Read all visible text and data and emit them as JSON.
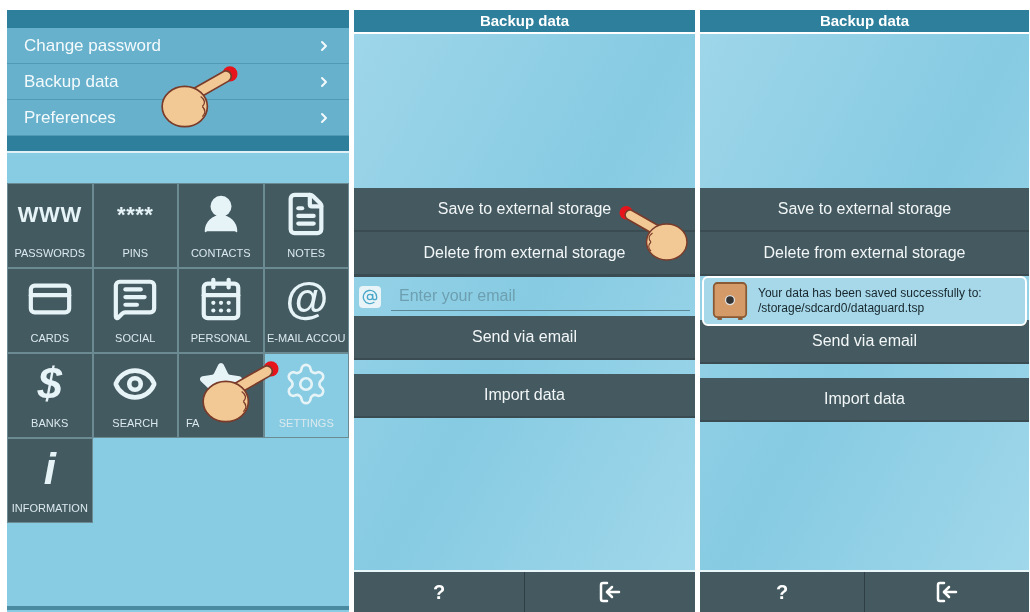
{
  "screens": [
    {
      "kind": "settings",
      "menu": [
        {
          "label": "Change password",
          "tapped": false
        },
        {
          "label": "Backup data",
          "tapped": true
        },
        {
          "label": "Preferences",
          "tapped": false
        }
      ],
      "tiles": [
        {
          "kind": "glyph",
          "label": "PASSWORDS",
          "glyph": "WWW",
          "selected": false,
          "tapped": false
        },
        {
          "kind": "glyph",
          "label": "PINS",
          "glyph": "****",
          "selected": false,
          "tapped": false
        },
        {
          "kind": "user",
          "label": "CONTACTS",
          "selected": false,
          "tapped": false
        },
        {
          "kind": "document",
          "label": "NOTES",
          "selected": false,
          "tapped": false
        },
        {
          "kind": "card",
          "label": "CARDS",
          "selected": false,
          "tapped": false
        },
        {
          "kind": "chat",
          "label": "SOCIAL",
          "selected": false,
          "tapped": false
        },
        {
          "kind": "calendar",
          "label": "PERSONAL",
          "selected": false,
          "tapped": false
        },
        {
          "kind": "glyph",
          "label": "E-MAIL ACCOU",
          "glyph": "@",
          "selected": false,
          "tapped": false
        },
        {
          "kind": "glyph",
          "label": "BANKS",
          "glyph": "$",
          "selected": false,
          "tapped": false
        },
        {
          "kind": "eye",
          "label": "SEARCH",
          "selected": false,
          "tapped": false
        },
        {
          "kind": "star",
          "label": "FA",
          "selected": false,
          "tapped": false
        },
        {
          "kind": "gear",
          "label": "SETTINGS",
          "selected": true,
          "tapped": true
        },
        {
          "kind": "glyph",
          "label": "INFORMATION",
          "glyph": "i",
          "selected": false,
          "tapped": false
        }
      ]
    },
    {
      "kind": "backup",
      "title": "Backup data",
      "actions": [
        {
          "kind": "button",
          "label": "Save to external storage",
          "tapped": true
        },
        {
          "kind": "button",
          "label": "Delete from external storage",
          "tapped": false
        },
        {
          "kind": "email",
          "placeholder": "Enter your email"
        },
        {
          "kind": "button",
          "label": "Send via email",
          "tapped": false
        }
      ],
      "import_button": {
        "label": "Import data"
      },
      "help": "?"
    },
    {
      "kind": "backup",
      "title": "Backup data",
      "actions": [
        {
          "kind": "button",
          "label": "Save to external storage",
          "tapped": false
        },
        {
          "kind": "button",
          "label": "Delete from external storage",
          "tapped": false
        },
        {
          "kind": "toast",
          "lines": [
            "Your data has been saved successfully to:",
            "/storage/sdcard0/dataguard.tsp"
          ]
        },
        {
          "kind": "button",
          "label": "Send via email",
          "tapped": false
        }
      ],
      "import_button": {
        "label": "Import data"
      },
      "help": "?"
    }
  ]
}
